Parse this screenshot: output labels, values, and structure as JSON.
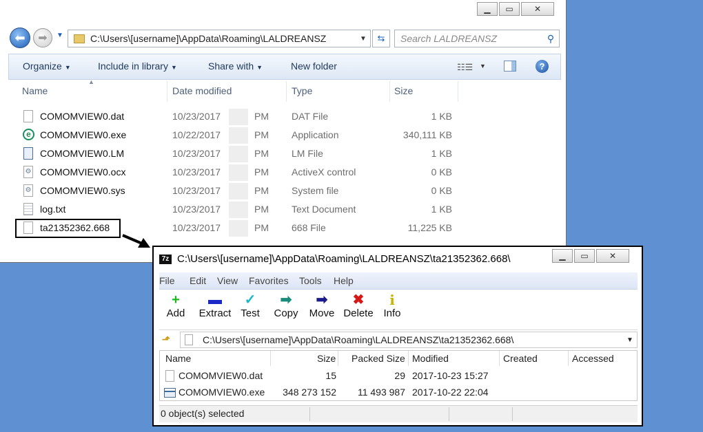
{
  "explorer": {
    "address_path": "C:\\Users\\[username]\\AppData\\Roaming\\LALDREANSZ",
    "search_placeholder": "Search LALDREANSZ",
    "toolbar": {
      "organize": "Organize",
      "include_in_library": "Include in library",
      "share_with": "Share with",
      "new_folder": "New folder"
    },
    "columns": {
      "name": "Name",
      "date_modified": "Date modified",
      "type": "Type",
      "size": "Size"
    },
    "files": [
      {
        "name": "COMOMVIEW0.dat",
        "date": "10/23/2017",
        "ampm": "PM",
        "type": "DAT File",
        "size": "1 KB",
        "icon": "generic-file-icon"
      },
      {
        "name": "COMOMVIEW0.exe",
        "date": "10/22/2017",
        "ampm": "PM",
        "type": "Application",
        "size": "340,111 KB",
        "icon": "eset-app-icon"
      },
      {
        "name": "COMOMVIEW0.LM",
        "date": "10/23/2017",
        "ampm": "PM",
        "type": "LM File",
        "size": "1 KB",
        "icon": "lm-file-icon"
      },
      {
        "name": "COMOMVIEW0.ocx",
        "date": "10/23/2017",
        "ampm": "PM",
        "type": "ActiveX control",
        "size": "0 KB",
        "icon": "gear-file-icon"
      },
      {
        "name": "COMOMVIEW0.sys",
        "date": "10/23/2017",
        "ampm": "PM",
        "type": "System file",
        "size": "0 KB",
        "icon": "gear-file-icon"
      },
      {
        "name": "log.txt",
        "date": "10/23/2017",
        "ampm": "PM",
        "type": "Text Document",
        "size": "1 KB",
        "icon": "text-file-icon"
      },
      {
        "name": "ta21352362.668",
        "date": "10/23/2017",
        "ampm": "PM",
        "type": "668 File",
        "size": "11,225 KB",
        "icon": "generic-file-icon"
      }
    ]
  },
  "zip": {
    "title": "C:\\Users\\[username]\\AppData\\Roaming\\LALDREANSZ\\ta21352362.668\\",
    "menu": [
      "File",
      "Edit",
      "View",
      "Favorites",
      "Tools",
      "Help"
    ],
    "tools": [
      {
        "label": "Add",
        "icon": "add-icon",
        "glyph": "+",
        "color": "#19b81c"
      },
      {
        "label": "Extract",
        "icon": "extract-icon",
        "glyph": "▬",
        "color": "#1a28c8"
      },
      {
        "label": "Test",
        "icon": "test-icon",
        "glyph": "✓",
        "color": "#18b8c8"
      },
      {
        "label": "Copy",
        "icon": "copy-icon",
        "glyph": "➡",
        "color": "#1a8a7a"
      },
      {
        "label": "Move",
        "icon": "move-icon",
        "glyph": "➡",
        "color": "#1a1a8a"
      },
      {
        "label": "Delete",
        "icon": "delete-icon",
        "glyph": "✖",
        "color": "#d81818"
      },
      {
        "label": "Info",
        "icon": "info-icon",
        "glyph": "i",
        "color": "#c8b400"
      }
    ],
    "path": "C:\\Users\\[username]\\AppData\\Roaming\\LALDREANSZ\\ta21352362.668\\",
    "columns": {
      "name": "Name",
      "size": "Size",
      "packed": "Packed Size",
      "modified": "Modified",
      "created": "Created",
      "accessed": "Accessed"
    },
    "rows": [
      {
        "name": "COMOMVIEW0.dat",
        "size": "15",
        "packed": "29",
        "modified": "2017-10-23 15:27",
        "icon": "generic-file-icon"
      },
      {
        "name": "COMOMVIEW0.exe",
        "size": "348 273 152",
        "packed": "11 493 987",
        "modified": "2017-10-22 22:04",
        "icon": "exe-file-icon"
      }
    ],
    "status": "0 object(s) selected"
  }
}
